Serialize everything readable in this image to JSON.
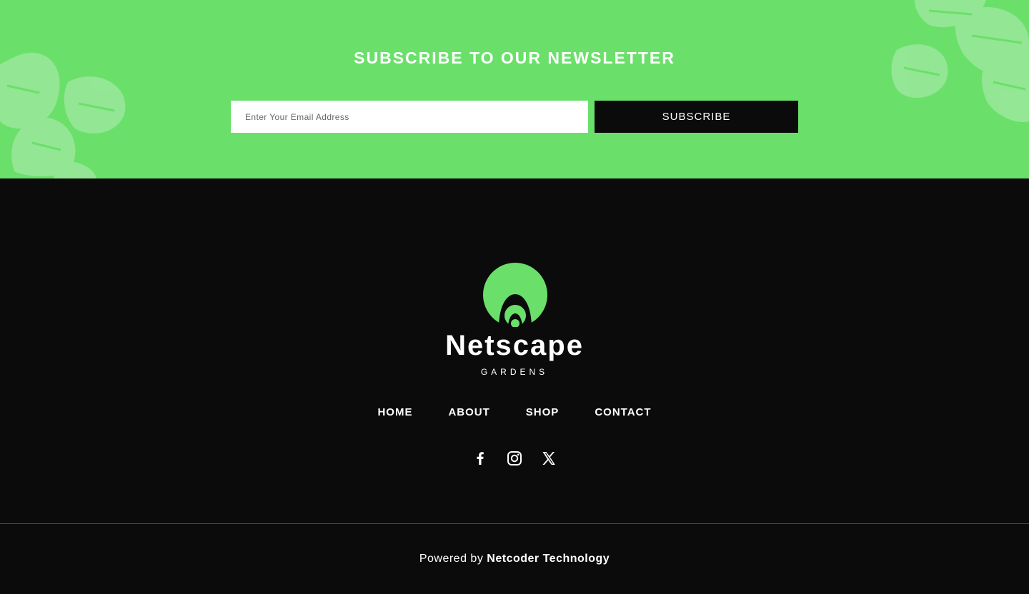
{
  "newsletter": {
    "title": "SUBSCRIBE TO OUR NEWSLETTER",
    "email_placeholder": "Enter Your Email Address",
    "subscribe_label": "SUBSCRIBE",
    "background_color": "#6ae06a"
  },
  "logo": {
    "name": "Netscape",
    "subtitle": "GARDENS",
    "accent_color": "#6ae06a"
  },
  "nav": {
    "items": [
      {
        "label": "HOME"
      },
      {
        "label": "ABOUT"
      },
      {
        "label": "SHOP"
      },
      {
        "label": "CONTACT"
      }
    ]
  },
  "social": {
    "icons": [
      "facebook-icon",
      "instagram-icon",
      "x-icon"
    ]
  },
  "footer": {
    "powered_prefix": "Powered by",
    "powered_brand": "Netcoder Technology"
  }
}
